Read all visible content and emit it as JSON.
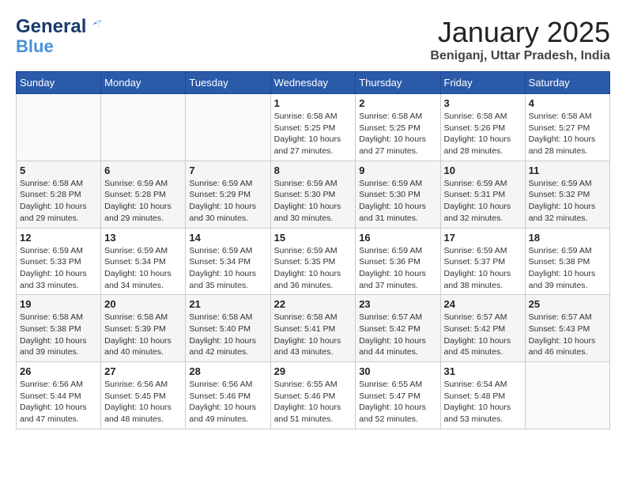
{
  "header": {
    "logo_general": "General",
    "logo_blue": "Blue",
    "month_title": "January 2025",
    "location": "Beniganj, Uttar Pradesh, India"
  },
  "days_of_week": [
    "Sunday",
    "Monday",
    "Tuesday",
    "Wednesday",
    "Thursday",
    "Friday",
    "Saturday"
  ],
  "weeks": [
    [
      {
        "day": "",
        "info": ""
      },
      {
        "day": "",
        "info": ""
      },
      {
        "day": "",
        "info": ""
      },
      {
        "day": "1",
        "info": "Sunrise: 6:58 AM\nSunset: 5:25 PM\nDaylight: 10 hours\nand 27 minutes."
      },
      {
        "day": "2",
        "info": "Sunrise: 6:58 AM\nSunset: 5:25 PM\nDaylight: 10 hours\nand 27 minutes."
      },
      {
        "day": "3",
        "info": "Sunrise: 6:58 AM\nSunset: 5:26 PM\nDaylight: 10 hours\nand 28 minutes."
      },
      {
        "day": "4",
        "info": "Sunrise: 6:58 AM\nSunset: 5:27 PM\nDaylight: 10 hours\nand 28 minutes."
      }
    ],
    [
      {
        "day": "5",
        "info": "Sunrise: 6:58 AM\nSunset: 5:28 PM\nDaylight: 10 hours\nand 29 minutes."
      },
      {
        "day": "6",
        "info": "Sunrise: 6:59 AM\nSunset: 5:28 PM\nDaylight: 10 hours\nand 29 minutes."
      },
      {
        "day": "7",
        "info": "Sunrise: 6:59 AM\nSunset: 5:29 PM\nDaylight: 10 hours\nand 30 minutes."
      },
      {
        "day": "8",
        "info": "Sunrise: 6:59 AM\nSunset: 5:30 PM\nDaylight: 10 hours\nand 30 minutes."
      },
      {
        "day": "9",
        "info": "Sunrise: 6:59 AM\nSunset: 5:30 PM\nDaylight: 10 hours\nand 31 minutes."
      },
      {
        "day": "10",
        "info": "Sunrise: 6:59 AM\nSunset: 5:31 PM\nDaylight: 10 hours\nand 32 minutes."
      },
      {
        "day": "11",
        "info": "Sunrise: 6:59 AM\nSunset: 5:32 PM\nDaylight: 10 hours\nand 32 minutes."
      }
    ],
    [
      {
        "day": "12",
        "info": "Sunrise: 6:59 AM\nSunset: 5:33 PM\nDaylight: 10 hours\nand 33 minutes."
      },
      {
        "day": "13",
        "info": "Sunrise: 6:59 AM\nSunset: 5:34 PM\nDaylight: 10 hours\nand 34 minutes."
      },
      {
        "day": "14",
        "info": "Sunrise: 6:59 AM\nSunset: 5:34 PM\nDaylight: 10 hours\nand 35 minutes."
      },
      {
        "day": "15",
        "info": "Sunrise: 6:59 AM\nSunset: 5:35 PM\nDaylight: 10 hours\nand 36 minutes."
      },
      {
        "day": "16",
        "info": "Sunrise: 6:59 AM\nSunset: 5:36 PM\nDaylight: 10 hours\nand 37 minutes."
      },
      {
        "day": "17",
        "info": "Sunrise: 6:59 AM\nSunset: 5:37 PM\nDaylight: 10 hours\nand 38 minutes."
      },
      {
        "day": "18",
        "info": "Sunrise: 6:59 AM\nSunset: 5:38 PM\nDaylight: 10 hours\nand 39 minutes."
      }
    ],
    [
      {
        "day": "19",
        "info": "Sunrise: 6:58 AM\nSunset: 5:38 PM\nDaylight: 10 hours\nand 39 minutes."
      },
      {
        "day": "20",
        "info": "Sunrise: 6:58 AM\nSunset: 5:39 PM\nDaylight: 10 hours\nand 40 minutes."
      },
      {
        "day": "21",
        "info": "Sunrise: 6:58 AM\nSunset: 5:40 PM\nDaylight: 10 hours\nand 42 minutes."
      },
      {
        "day": "22",
        "info": "Sunrise: 6:58 AM\nSunset: 5:41 PM\nDaylight: 10 hours\nand 43 minutes."
      },
      {
        "day": "23",
        "info": "Sunrise: 6:57 AM\nSunset: 5:42 PM\nDaylight: 10 hours\nand 44 minutes."
      },
      {
        "day": "24",
        "info": "Sunrise: 6:57 AM\nSunset: 5:42 PM\nDaylight: 10 hours\nand 45 minutes."
      },
      {
        "day": "25",
        "info": "Sunrise: 6:57 AM\nSunset: 5:43 PM\nDaylight: 10 hours\nand 46 minutes."
      }
    ],
    [
      {
        "day": "26",
        "info": "Sunrise: 6:56 AM\nSunset: 5:44 PM\nDaylight: 10 hours\nand 47 minutes."
      },
      {
        "day": "27",
        "info": "Sunrise: 6:56 AM\nSunset: 5:45 PM\nDaylight: 10 hours\nand 48 minutes."
      },
      {
        "day": "28",
        "info": "Sunrise: 6:56 AM\nSunset: 5:46 PM\nDaylight: 10 hours\nand 49 minutes."
      },
      {
        "day": "29",
        "info": "Sunrise: 6:55 AM\nSunset: 5:46 PM\nDaylight: 10 hours\nand 51 minutes."
      },
      {
        "day": "30",
        "info": "Sunrise: 6:55 AM\nSunset: 5:47 PM\nDaylight: 10 hours\nand 52 minutes."
      },
      {
        "day": "31",
        "info": "Sunrise: 6:54 AM\nSunset: 5:48 PM\nDaylight: 10 hours\nand 53 minutes."
      },
      {
        "day": "",
        "info": ""
      }
    ]
  ]
}
